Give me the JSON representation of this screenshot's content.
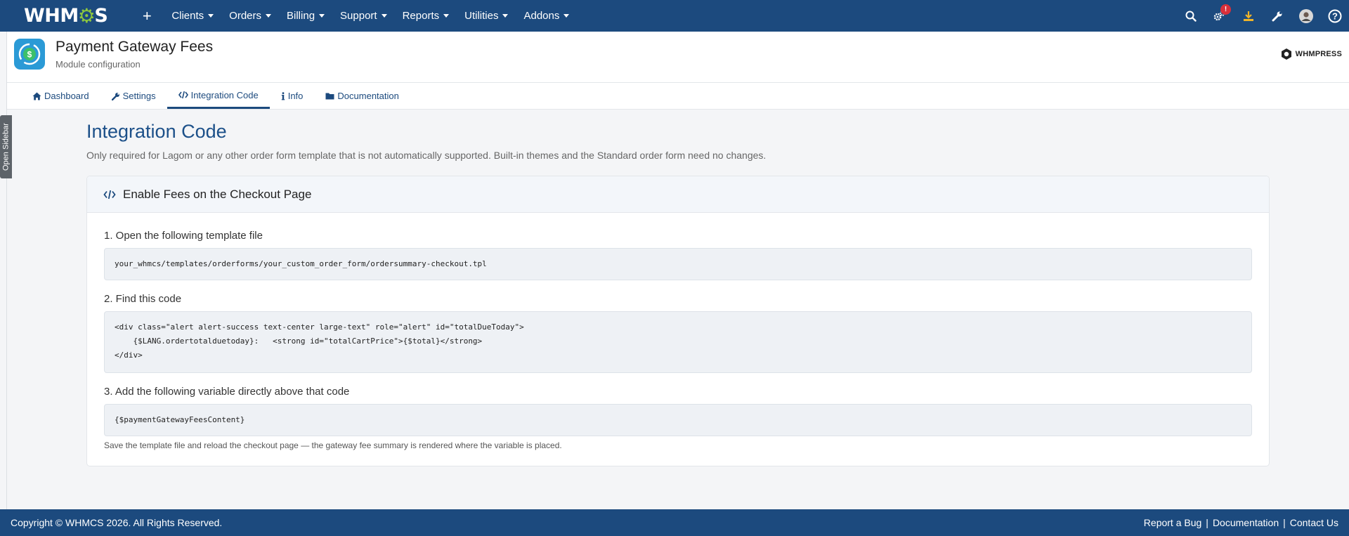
{
  "topnav": {
    "logo_text_a": "WHM",
    "logo_text_b": "S",
    "plus_label": "+",
    "menu": [
      {
        "label": "Clients"
      },
      {
        "label": "Orders"
      },
      {
        "label": "Billing"
      },
      {
        "label": "Support"
      },
      {
        "label": "Reports"
      },
      {
        "label": "Utilities"
      },
      {
        "label": "Addons"
      }
    ],
    "alert_badge": "!",
    "icons": [
      "search-icon",
      "gears-icon",
      "download-icon",
      "wrench-icon",
      "avatar",
      "help-icon"
    ]
  },
  "module": {
    "title": "Payment Gateway Fees",
    "subtitle": "Module configuration",
    "brand": "WHMPRESS"
  },
  "tabs": [
    {
      "label": "Dashboard",
      "icon": "home-icon"
    },
    {
      "label": "Settings",
      "icon": "wrench-icon"
    },
    {
      "label": "Integration Code",
      "icon": "code-icon",
      "active": true
    },
    {
      "label": "Info",
      "icon": "info-icon"
    },
    {
      "label": "Documentation",
      "icon": "folder-icon"
    }
  ],
  "sidebar": {
    "toggle_label": "Open Sidebar"
  },
  "page": {
    "title": "Integration Code",
    "description": "Only required for Lagom or any other order form template that is not automatically supported. Built-in themes and the Standard order form need no changes."
  },
  "card": {
    "title": "Enable Fees on the Checkout Page",
    "step1": "1. Open the following template file",
    "code1": "your_whmcs/templates/orderforms/your_custom_order_form/ordersummary-checkout.tpl",
    "step2": "2. Find this code",
    "code2": "<div class=\"alert alert-success text-center large-text\" role=\"alert\" id=\"totalDueToday\">\n    {$LANG.ordertotalduetoday}:   <strong id=\"totalCartPrice\">{$total}</strong>\n</div>",
    "step3": "3. Add the following variable directly above that code",
    "code3": "{$paymentGatewayFeesContent}",
    "note": "Save the template file and reload the checkout page — the gateway fee summary is rendered where the variable is placed."
  },
  "footer": {
    "copyright": "Copyright © WHMCS 2026. All Rights Reserved.",
    "links": [
      "Report a Bug",
      "Documentation",
      "Contact Us"
    ],
    "separator": "|"
  },
  "colors": {
    "nav_bg": "#1c4a7e",
    "accent": "#1c5089",
    "gear_green": "#8cc63f",
    "alert_red": "#d9303a"
  }
}
